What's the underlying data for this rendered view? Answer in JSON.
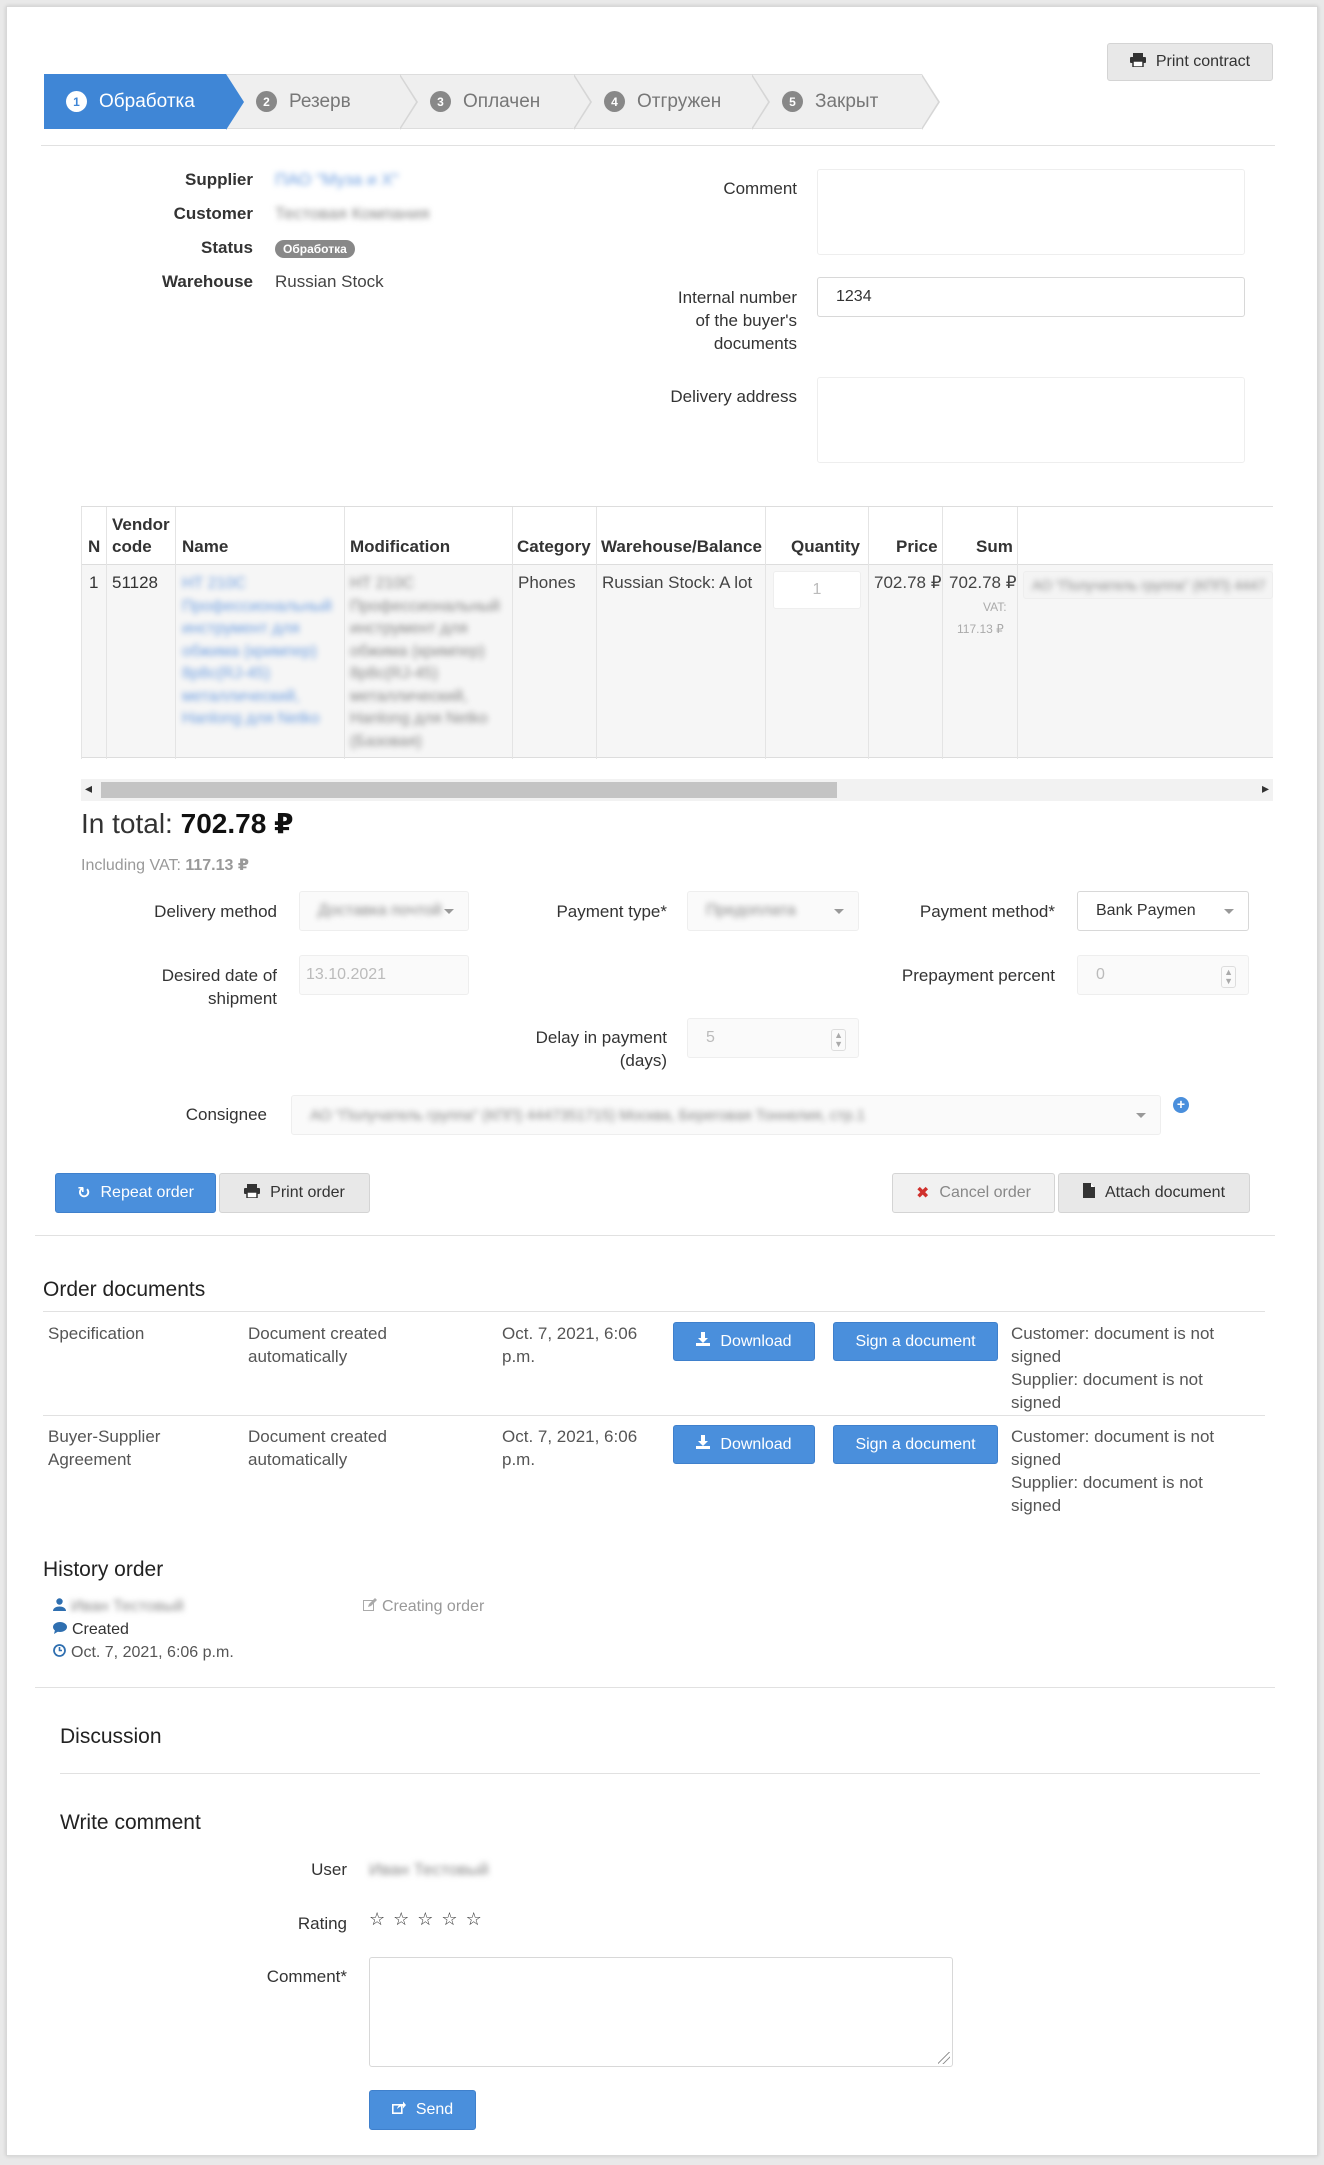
{
  "header": {
    "print_contract_label": "Print contract",
    "steps": [
      {
        "num": "1",
        "label": "Обработка",
        "active": true
      },
      {
        "num": "2",
        "label": "Резерв",
        "active": false
      },
      {
        "num": "3",
        "label": "Оплачен",
        "active": false
      },
      {
        "num": "4",
        "label": "Отгружен",
        "active": false
      },
      {
        "num": "5",
        "label": "Закрыт",
        "active": false
      }
    ]
  },
  "info": {
    "supplier_label": "Supplier",
    "supplier_value": "ПАО \"Муза и Х\"",
    "customer_label": "Customer",
    "customer_value": "Тестовая Компания",
    "status_label": "Status",
    "status_value": "Обработка",
    "warehouse_label": "Warehouse",
    "warehouse_value": "Russian Stock",
    "comment_label": "Comment",
    "internal_number_label_1": "Internal number",
    "internal_number_label_2": "of the buyer's",
    "internal_number_label_3": "documents",
    "internal_number_value": "1234",
    "delivery_address_label": "Delivery address"
  },
  "table": {
    "headers": {
      "n": "N",
      "vendor_code_1": "Vendor",
      "vendor_code_2": "code",
      "name": "Name",
      "modification": "Modification",
      "category": "Category",
      "warehouse": "Warehouse/Balance",
      "quantity": "Quantity",
      "price": "Price",
      "sum": "Sum"
    },
    "row": {
      "n": "1",
      "vendor_code": "51128",
      "name_lines": [
        "НТ 210С",
        "Профессиональный",
        "инструмент для",
        "обжима (кримпер)",
        "8p8c(RJ-45)",
        "металлический,",
        "Hanlong для Netko"
      ],
      "mod_lines": [
        "НТ 210С",
        "Профессиональный",
        "инструмент для",
        "обжима (кримпер)",
        "8p8c(RJ-45)",
        "металлический,",
        "Hanlong для Netko",
        "(Базовая)"
      ],
      "category": "Phones",
      "warehouse": "Russian Stock: A lot",
      "quantity": "1",
      "price": "702.78 ₽",
      "sum": "702.78 ₽",
      "vat_label": "VAT:",
      "vat_value": "117.13 ₽",
      "consignee": "АО \"Получатель группа\" (КПП) 4447"
    }
  },
  "totals": {
    "total_label": "In total:",
    "total_value": "702.78 ₽",
    "vat_label": "Including VAT:",
    "vat_value": "117.13 ₽"
  },
  "form": {
    "delivery_method_label": "Delivery method",
    "delivery_method_value": "Доставка почтой",
    "payment_type_label": "Payment type*",
    "payment_type_value": "Предоплата",
    "payment_method_label": "Payment method*",
    "payment_method_value": "Bank Paymen",
    "desired_date_label_1": "Desired date of",
    "desired_date_label_2": "shipment",
    "desired_date_value": "13.10.2021",
    "prepayment_label": "Prepayment percent",
    "prepayment_value": "0",
    "delay_label_1": "Delay in payment",
    "delay_label_2": "(days)",
    "delay_value": "5",
    "consignee_label": "Consignee",
    "consignee_value": "АО \"Получатель группа\" (КПП) 4447351715) Москва, Береговая Тоннелия, стр.1"
  },
  "actions": {
    "repeat_order": "Repeat order",
    "print_order": "Print order",
    "cancel_order": "Cancel order",
    "attach_document": "Attach document"
  },
  "documents": {
    "title": "Order documents",
    "download_label": "Download",
    "sign_label": "Sign a document",
    "items": [
      {
        "name": "Specification",
        "created_1": "Document created",
        "created_2": "automatically",
        "date_1": "Oct. 7, 2021, 6:06",
        "date_2": "p.m.",
        "customer_status_1": "Customer: document is not",
        "customer_status_2": "signed",
        "supplier_status_1": "Supplier: document is not",
        "supplier_status_2": "signed"
      },
      {
        "name": "Buyer-Supplier",
        "name_2": "Agreement",
        "created_1": "Document created",
        "created_2": "automatically",
        "date_1": "Oct. 7, 2021, 6:06",
        "date_2": "p.m.",
        "customer_status_1": "Customer: document is not",
        "customer_status_2": "signed",
        "supplier_status_1": "Supplier: document is not",
        "supplier_status_2": "signed"
      }
    ]
  },
  "history": {
    "title": "History order",
    "user": "Иван Тестовый",
    "action": "Created",
    "date": "Oct. 7, 2021, 6:06 p.m.",
    "event": "Creating order"
  },
  "discussion": {
    "title": "Discussion",
    "write_title": "Write comment",
    "user_label": "User",
    "user_value": "Иван Тестовый",
    "rating_label": "Rating",
    "rating_max": 5,
    "comment_label": "Comment*",
    "send_label": "Send"
  },
  "colors": {
    "primary": "#4a8fdc",
    "step_active": "#3f86d6",
    "cancel_icon": "#d0312d",
    "link_blur": "#6f9fe0"
  }
}
